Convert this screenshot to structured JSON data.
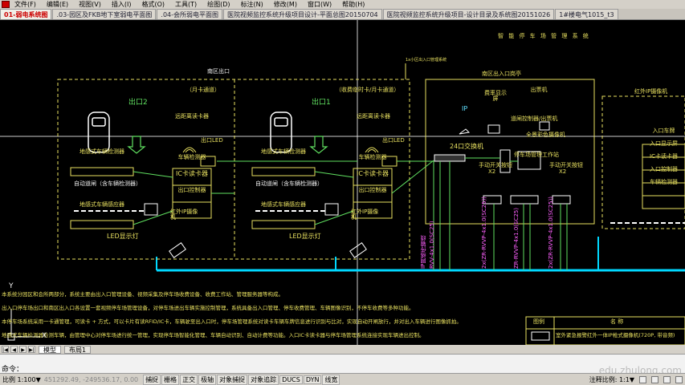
{
  "menu": [
    "文件(F)",
    "编辑(E)",
    "视图(V)",
    "插入(I)",
    "格式(O)",
    "工具(T)",
    "绘图(D)",
    "标注(N)",
    "修改(M)",
    "窗口(W)",
    "帮助(H)"
  ],
  "tabs": [
    "01-弱电系统图",
    ".03-园区及FKB地下室弱电平面图",
    ".04-会所弱电平面图",
    "医院视频监控系统升级项目设计-平面总图20150704",
    "医院视频监控系统升级项目-设计目录及系统图20151026",
    "1#楼电气1015_t3"
  ],
  "drawing": {
    "title": "智 能 停 车 场 管 理 系 统",
    "exit_label": "南区出口",
    "exit_center_label": "南区出入口岗亭",
    "exit2": "出口2",
    "exit1": "出口1",
    "lane2_note": "（月卡通道）",
    "lane1_note": "（收费临时卡/月卡通道）",
    "reader_label": "远距离读卡器",
    "led_label": "出口LED",
    "vehicle_detector": "地感式车辆检测器",
    "barrier": "自动道闸（含车辆检测器）",
    "vehicle_detector2": "地感式车辆感应器",
    "controller_items": [
      "车辆检测器",
      "IC卡读卡器",
      "出口控制器"
    ],
    "ip_camera": "红外IP摄像机",
    "led_display": "LED显示灯",
    "booth_items": [
      "费率显示屏",
      "出票机",
      "全景彩色摄像机"
    ],
    "switch_label": "24口交换机",
    "gate_controller": "道闸控制器/出票机",
    "manual_switch": "手动开关按钮",
    "manual_switch2": "手动开关按钮",
    "workstation": "停车场管理工作站",
    "x2a": "X2",
    "x2b": "X2",
    "entry_panel_title": "红外IP摄像机",
    "entry_items": [
      "入口车牌",
      "入口显示屏",
      "IC卡读卡器",
      "入口控制器",
      "车辆检测器"
    ],
    "cable_labels": [
      "IP网络传输线",
      "RVV-4x1.0(SC25)",
      "2x(ZR-RVVP-4x1.0(SC25))",
      "ZR-RVVP-4x1.0(SC25)",
      "2x(ZR-RVVP-4x1.0(SC25))"
    ],
    "desc_lines": [
      "本系统分园区和会所两部分，系统主要由出入口管理设备、视频采集及停车场收费设备、收费工作站、管理服务器等构成。",
      "出入口停车场出口和南区出入口各设置一套视频停车场管理设备，对停车场进出车辆实施控制管理，系统具备出入口管理、停车收费管理、车辆图像识别，不停车收费等多种功能。",
      "本停车场系统采用一卡通管理，可读卡 + 方式，可以卡片有读RFID/IC卡，车辆驶至出入口时，停车场管理系统对读卡车辆车牌信息进行识别与比对，实现自动开闸放行，并对出入车辆进行图像抓拍。",
      "地感式车辆检测器检测车辆，由管理中心对停车场进行统一管理，实现停车场智能化管理、车辆自动识别、自动计费等功能。入口IC卡读卡器与停车场管理系统连接实现车辆进出控制。"
    ],
    "legend": {
      "header_symbol": "图例",
      "header_name": "名 称",
      "row_text": "室外紧急报警红外一体IP枪式摄像机(720P, 带音频)"
    },
    "small_note": "1x小区出入口管理系统",
    "ip_label": "IP"
  },
  "layout_tabs": [
    "模型",
    "布局1"
  ],
  "command": {
    "prompt": "命令："
  },
  "watermark": "edu.zhulong.com",
  "status": {
    "scale": "比例 1:100▼",
    "coords": "451292.49, -249536.17, 0.00",
    "toggles": [
      "捕捉",
      "栅格",
      "正交",
      "极轴",
      "对象捕捉",
      "对象追踪",
      "DUCS",
      "DYN",
      "线宽"
    ],
    "annotation_scale": "注释比例: 1:1▼",
    "colors": {
      "yellow": "#e8e060",
      "green": "#60e060",
      "cyan": "#40e0ff",
      "white": "#f2f2f2"
    }
  }
}
